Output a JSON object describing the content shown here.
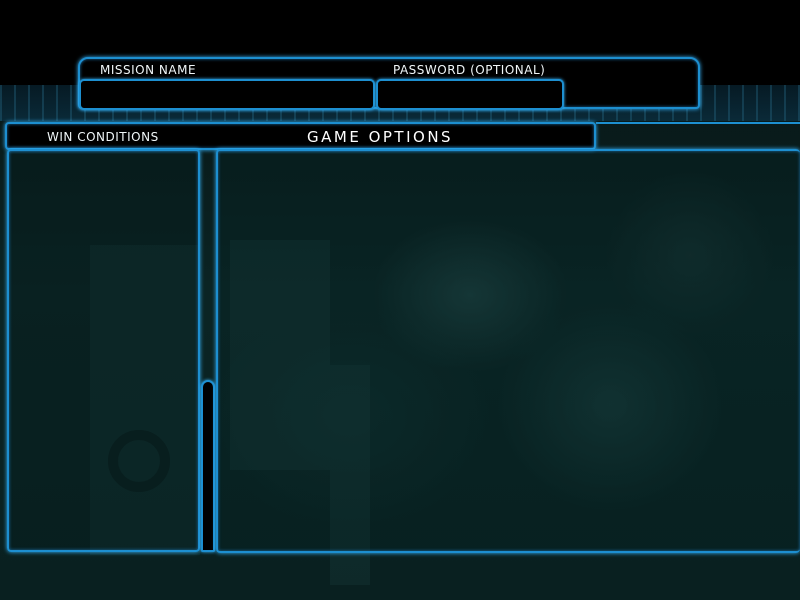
{
  "mission": {
    "name_label": "MISSION NAME",
    "name_value": "",
    "password_label": "PASSWORD (OPTIONAL)",
    "password_value": ""
  },
  "sections": {
    "win_conditions_label": "WIN CONDITIONS",
    "game_options_title": "GAME OPTIONS"
  },
  "colors": {
    "accent": "#1d8fd0",
    "glow": "#36b6ff",
    "background": "#000000",
    "panel_fill": "#0b2424"
  }
}
